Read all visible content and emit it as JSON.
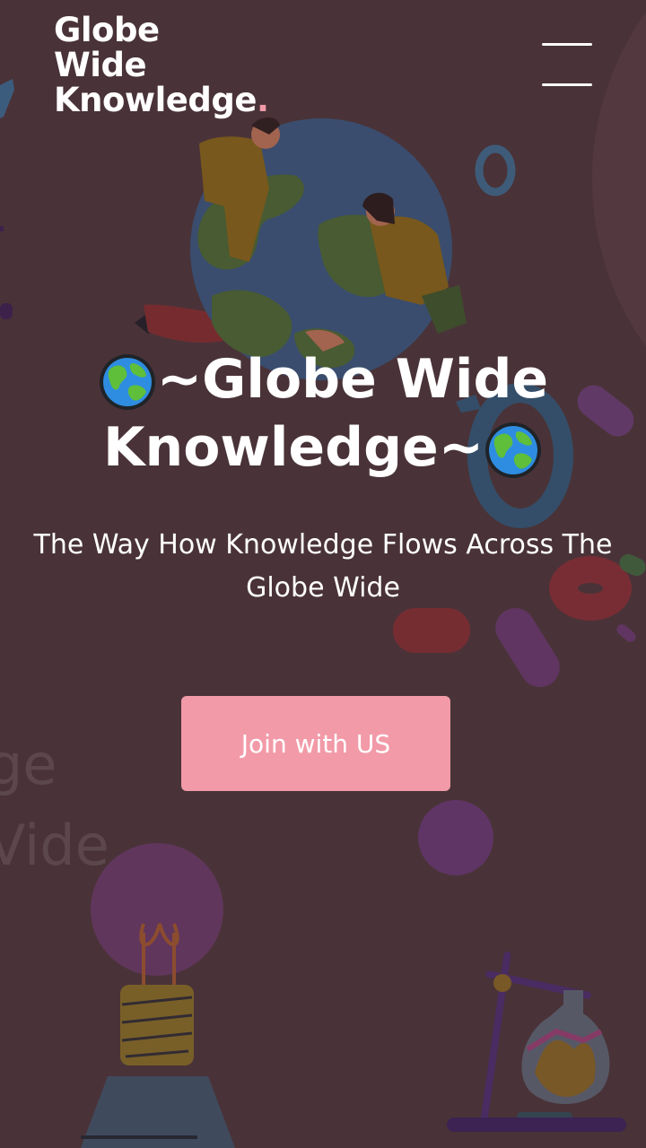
{
  "brand": {
    "line1": "Globe",
    "line2": "Wide",
    "line3": "Knowledge",
    "dot": "."
  },
  "menu": {
    "icon": "hamburger-icon"
  },
  "hero": {
    "title_start_icon": "earth-globe-emoji",
    "title_line1": "~Globe Wide",
    "title_line2": "Knowledge~",
    "title_end_icon": "earth-globe-emoji",
    "subtitle": "The Way How Knowledge Flows Across The Globe Wide",
    "cta_label": "Join with US"
  },
  "background_text": {
    "line1": "ge",
    "line2": "Vide"
  },
  "colors": {
    "background": "#4c363b",
    "accent": "#f29aa8",
    "text": "#ffffff"
  }
}
